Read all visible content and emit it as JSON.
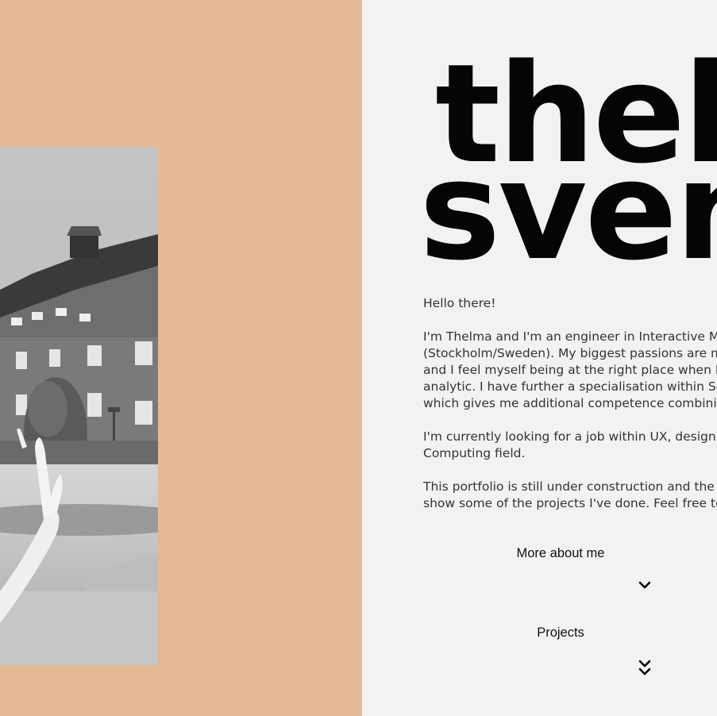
{
  "name": {
    "first": "thelma",
    "last": "svensson"
  },
  "intro": {
    "greeting": "Hello there!",
    "paragraph1_lines": [
      "I'm Thelma and I'm an engineer in Interactive Media",
      "(Stockholm/Sweden). My biggest passions are music",
      "and I feel myself being at the right place when I c",
      "analytic. I have further a specialisation within Sou",
      "which gives me additional competence combinin"
    ],
    "paragraph2_lines": [
      "I'm currently looking for a job within UX, design c",
      "Computing field."
    ],
    "paragraph3_lines": [
      "This portfolio is still under construction and the a",
      "show some of the projects I've done. Feel free to"
    ]
  },
  "nav": {
    "more_about_me": "More about me",
    "projects": "Projects"
  },
  "icons": {
    "more_about_me": "chevron-down-icon",
    "projects": "double-chevron-down-icon"
  },
  "colors": {
    "left_panel": "#e3ba95",
    "right_panel": "#f2f2f2",
    "text": "#333333"
  }
}
